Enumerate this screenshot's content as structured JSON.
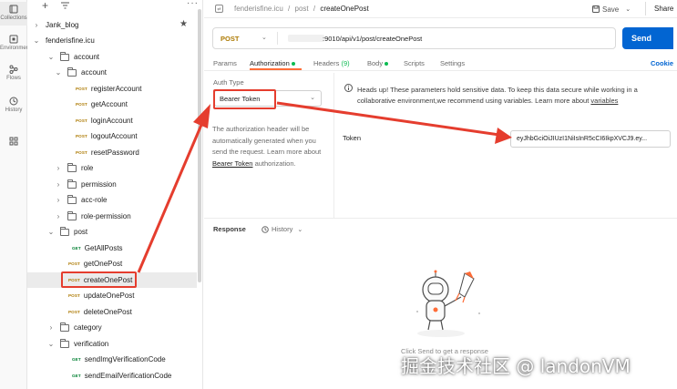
{
  "rail": [
    {
      "label": "Collections",
      "icon": "collections-icon"
    },
    {
      "label": "Environments",
      "icon": "environments-icon"
    },
    {
      "label": "Flows",
      "icon": "flows-icon"
    },
    {
      "label": "History",
      "icon": "history-icon"
    },
    {
      "label": "",
      "icon": "apps-icon"
    }
  ],
  "sidebar": {
    "tree": [
      {
        "label": "Jank_blog",
        "kind": "collection"
      },
      {
        "label": "fenderisfine.icu",
        "kind": "collection"
      },
      {
        "label": "account",
        "kind": "folder"
      },
      {
        "label": "account",
        "kind": "folder"
      },
      {
        "label": "registerAccount",
        "method": "POST"
      },
      {
        "label": "getAccount",
        "method": "POST"
      },
      {
        "label": "loginAccount",
        "method": "POST"
      },
      {
        "label": "logoutAccount",
        "method": "POST"
      },
      {
        "label": "resetPassword",
        "method": "POST"
      },
      {
        "label": "role",
        "kind": "folder"
      },
      {
        "label": "permission",
        "kind": "folder"
      },
      {
        "label": "acc-role",
        "kind": "folder"
      },
      {
        "label": "role-permission",
        "kind": "folder"
      },
      {
        "label": "post",
        "kind": "folder"
      },
      {
        "label": "GetAllPosts",
        "method": "GET"
      },
      {
        "label": "getOnePost",
        "method": "POST"
      },
      {
        "label": "createOnePost",
        "method": "POST"
      },
      {
        "label": "updateOnePost",
        "method": "POST"
      },
      {
        "label": "deleteOnePost",
        "method": "POST"
      },
      {
        "label": "category",
        "kind": "folder"
      },
      {
        "label": "verification",
        "kind": "folder"
      },
      {
        "label": "sendImgVerificationCode",
        "method": "GET"
      },
      {
        "label": "sendEmailVerificationCode",
        "method": "GET"
      }
    ]
  },
  "header": {
    "crumb_root": "fenderisfine.icu",
    "crumb_sep": "/",
    "crumb_folder": "post",
    "crumb_request": "createOnePost",
    "save_label": "Save",
    "share_label": "Share"
  },
  "request": {
    "method": "POST",
    "url": ":9010/api/v1/post/createOnePost",
    "send_label": "Send",
    "tabs": [
      {
        "label": "Params",
        "dot": false
      },
      {
        "label": "Authorization",
        "dot": true
      },
      {
        "label": "Headers",
        "count": "(9)"
      },
      {
        "label": "Body",
        "dot": true
      },
      {
        "label": "Scripts"
      },
      {
        "label": "Settings"
      }
    ],
    "cookies_label": "Cookie"
  },
  "auth": {
    "type_label": "Auth Type",
    "type_value": "Bearer Token",
    "description": "The authorization header will be automatically generated when you send the request. Learn more about",
    "link": "Bearer Token",
    "description_tail": "authorization.",
    "notice_text": "Heads up! These parameters hold sensitive data. To keep this data secure while working in a collaborative environment,we recommend using variables. Learn more about",
    "notice_link": "variables",
    "token_label": "Token",
    "token_value": "eyJhbGciOiJIUzI1NiIsInR5cCI6IkpXVCJ9.ey..."
  },
  "response": {
    "title": "Response",
    "history_label": "History",
    "empty_text": "Click Send to get a response"
  },
  "watermark": "掘金技术社区 @ landonVM",
  "colors": {
    "accent": "#ff6c37",
    "send": "#0265d2",
    "post": "#ad7a03",
    "get": "#007f31",
    "annotation": "#e53d2e"
  }
}
